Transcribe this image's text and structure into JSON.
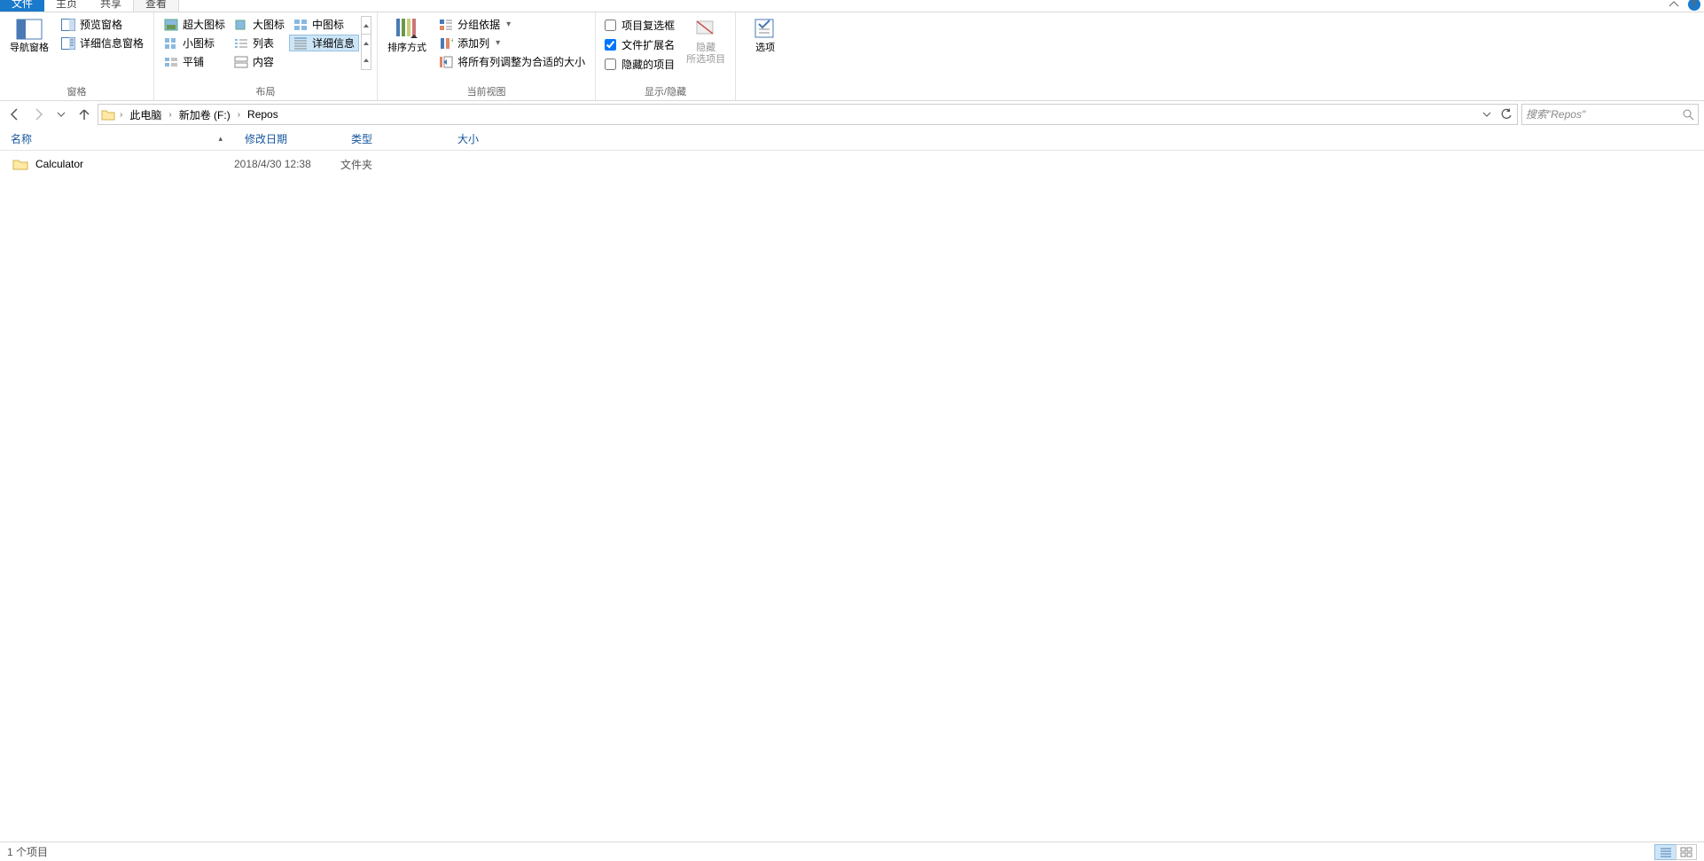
{
  "tabs": {
    "file": "文件",
    "home": "主页",
    "share": "共享",
    "view": "查看"
  },
  "ribbon": {
    "panes": {
      "nav_pane": "导航窗格",
      "preview": "预览窗格",
      "details_pane": "详细信息窗格",
      "group_label": "窗格"
    },
    "layout": {
      "extra_large": "超大图标",
      "large": "大图标",
      "medium": "中图标",
      "small": "小图标",
      "list": "列表",
      "details": "详细信息",
      "tiles": "平铺",
      "content": "内容",
      "group_label": "布局"
    },
    "current_view": {
      "sort_by": "排序方式",
      "group_by": "分组依据",
      "add_columns": "添加列",
      "autosize": "将所有列调整为合适的大小",
      "group_label": "当前视图"
    },
    "show_hide": {
      "item_checkboxes": "项目复选框",
      "file_ext": "文件扩展名",
      "hidden_items": "隐藏的项目",
      "hide": "隐藏",
      "hide_sub": "所选项目",
      "group_label": "显示/隐藏"
    },
    "options": "选项"
  },
  "breadcrumbs": [
    "此电脑",
    "新加卷 (F:)",
    "Repos"
  ],
  "search_placeholder": "搜索\"Repos\"",
  "columns": {
    "name": "名称",
    "date": "修改日期",
    "type": "类型",
    "size": "大小"
  },
  "rows": [
    {
      "name": "Calculator",
      "date": "2018/4/30 12:38",
      "type": "文件夹",
      "size": ""
    }
  ],
  "status": {
    "count": "1 个项目"
  }
}
